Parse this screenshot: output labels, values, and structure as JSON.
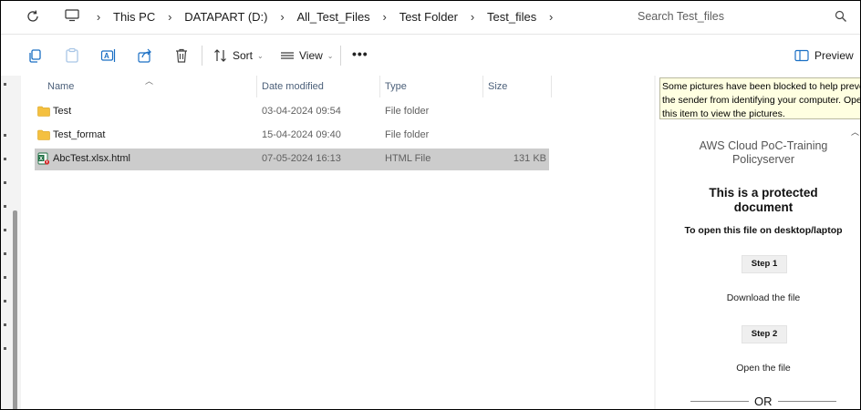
{
  "address": {
    "crumbs": [
      "This PC",
      "DATAPART (D:)",
      "All_Test_Files",
      "Test Folder",
      "Test_files"
    ],
    "search_placeholder": "Search Test_files"
  },
  "toolbar": {
    "sort_label": "Sort",
    "view_label": "View",
    "more_label": "•••",
    "preview_label": "Preview"
  },
  "columns": {
    "name": "Name",
    "date": "Date modified",
    "type": "Type",
    "size": "Size"
  },
  "files": [
    {
      "name": "Test",
      "date": "03-04-2024 09:54",
      "type": "File folder",
      "size": "",
      "icon": "folder-icon"
    },
    {
      "name": "Test_format",
      "date": "15-04-2024 09:40",
      "type": "File folder",
      "size": "",
      "icon": "folder-icon"
    },
    {
      "name": "AbcTest.xlsx.html",
      "date": "07-05-2024 16:13",
      "type": "HTML File",
      "size": "131 KB",
      "icon": "excel-html-icon",
      "selected": true
    }
  ],
  "preview": {
    "infobar_lines": [
      "Some pictures have been blocked to help preven",
      "the sender from identifying your computer. Open",
      "this item to view the pictures."
    ],
    "title_lines": [
      "AWS Cloud PoC-Training",
      "Policyserver"
    ],
    "heading_lines": [
      "This is a protected",
      "document"
    ],
    "subheading": "To open this file on desktop/laptop",
    "step1_label": "Step 1",
    "step1_text": "Download the file",
    "step2_label": "Step 2",
    "step2_text": "Open the file",
    "or_text": "OR"
  },
  "colors": {
    "selection": "#cccccc",
    "folder": "#f4c040",
    "infobar": "#ffffe1",
    "excel_green": "#1d6f42"
  }
}
